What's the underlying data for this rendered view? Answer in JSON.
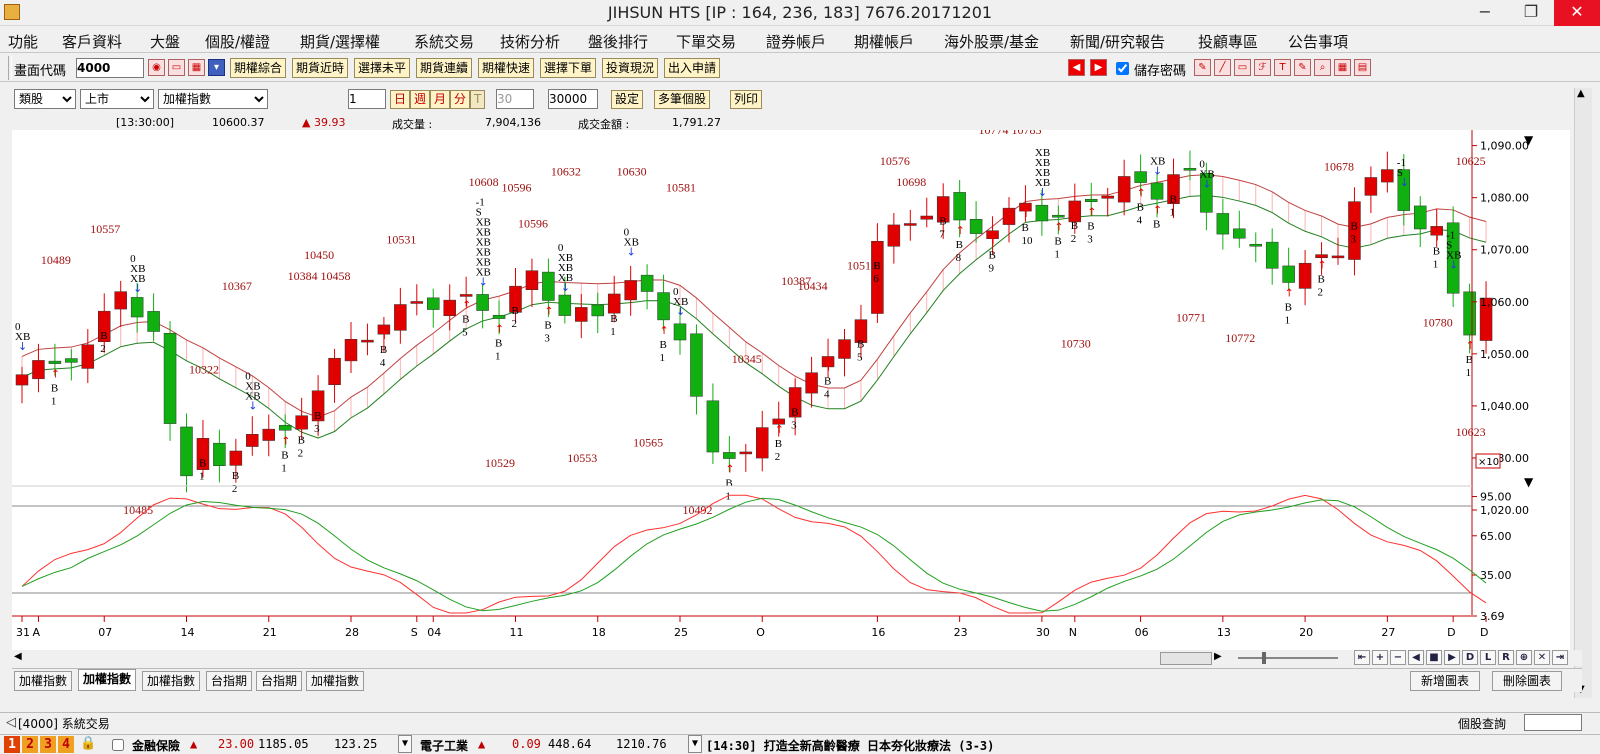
{
  "window": {
    "title": "JIHSUN HTS     [IP : 164, 236, 183] 7676.20171201"
  },
  "menu": [
    "功能",
    "客戶資料",
    "大盤",
    "個股/權證",
    "期貨/選擇權",
    "系統交易",
    "技術分析",
    "盤後排行",
    "下單交易",
    "證券帳戶",
    "期權帳戶",
    "海外股票/基金",
    "新聞/研究報告",
    "投顧專區",
    "公告事項"
  ],
  "toolbar1": {
    "screen_code_label": "畫面代碼",
    "screen_code_value": "4000",
    "buttons": [
      "期權綜合",
      "期貨近時",
      "選擇未平",
      "期貨連續",
      "期權快速",
      "選擇下單",
      "投資現況",
      "出入申請"
    ],
    "save_password_label": "儲存密碼"
  },
  "toolbar2": {
    "category": "類股",
    "market": "上市",
    "index": "加權指數",
    "count_value": "1",
    "periods": [
      "日",
      "週",
      "月",
      "分",
      "T"
    ],
    "period_value": "30",
    "bars_value": "30000",
    "buttons": [
      "設定",
      "多筆個股",
      "列印"
    ]
  },
  "info": {
    "time": "[13:30:00]",
    "price": "10600.37",
    "change": "▲ 39.93",
    "volume_label": "成交量 :",
    "volume": "7,904,136",
    "amount_label": "成交金額 :",
    "amount": "1,791.27"
  },
  "chart_data": {
    "type": "candlestick",
    "price_axis": {
      "ticks": [
        "1,090.00",
        "1,080.00",
        "1,070.00",
        "1,060.00",
        "1,050.00",
        "1,040.00",
        "1,030.00",
        "1,020.00"
      ],
      "multiplier": "×10",
      "ylim": [
        1020,
        1093
      ]
    },
    "osc_axis": {
      "ticks": [
        "95.00",
        "65.00",
        "35.00",
        "3.69"
      ]
    },
    "x_ticks": [
      "31",
      "A",
      "07",
      "14",
      "21",
      "28",
      "S",
      "04",
      "11",
      "18",
      "25",
      "O",
      "16",
      "23",
      "30",
      "N",
      "06",
      "13",
      "20",
      "27",
      "D",
      "D"
    ],
    "price_labels": [
      {
        "t": "10489",
        "x": 2,
        "v": 1068
      },
      {
        "t": "10557",
        "x": 5,
        "v": 1074
      },
      {
        "t": "10485",
        "x": 7,
        "v": 1020
      },
      {
        "t": "10367",
        "x": 13,
        "v": 1063
      },
      {
        "t": "10322",
        "x": 11,
        "v": 1047
      },
      {
        "t": "10450",
        "x": 18,
        "v": 1069
      },
      {
        "t": "10384",
        "x": 17,
        "v": 1065
      },
      {
        "t": "10458",
        "x": 19,
        "v": 1065
      },
      {
        "t": "10531",
        "x": 23,
        "v": 1072
      },
      {
        "t": "10608",
        "x": 28,
        "v": 1083
      },
      {
        "t": "10596",
        "x": 30,
        "v": 1082
      },
      {
        "t": "10596",
        "x": 31,
        "v": 1075
      },
      {
        "t": "10632",
        "x": 33,
        "v": 1085
      },
      {
        "t": "10630",
        "x": 37,
        "v": 1085
      },
      {
        "t": "10581",
        "x": 40,
        "v": 1082
      },
      {
        "t": "10529",
        "x": 29,
        "v": 1029
      },
      {
        "t": "10553",
        "x": 34,
        "v": 1030
      },
      {
        "t": "10565",
        "x": 38,
        "v": 1033
      },
      {
        "t": "10492",
        "x": 41,
        "v": 1020
      },
      {
        "t": "10345",
        "x": 44,
        "v": 1049
      },
      {
        "t": "10387",
        "x": 47,
        "v": 1064
      },
      {
        "t": "10434",
        "x": 48,
        "v": 1063
      },
      {
        "t": "10518",
        "x": 51,
        "v": 1067
      },
      {
        "t": "10576",
        "x": 53,
        "v": 1087
      },
      {
        "t": "10698",
        "x": 54,
        "v": 1083
      },
      {
        "t": "10774",
        "x": 59,
        "v": 1093
      },
      {
        "t": "10785",
        "x": 61,
        "v": 1093
      },
      {
        "t": "10730",
        "x": 64,
        "v": 1052
      },
      {
        "t": "10771",
        "x": 71,
        "v": 1057
      },
      {
        "t": "10772",
        "x": 74,
        "v": 1053
      },
      {
        "t": "10678",
        "x": 80,
        "v": 1086
      },
      {
        "t": "10625",
        "x": 88,
        "v": 1087
      },
      {
        "t": "10780",
        "x": 86,
        "v": 1056
      },
      {
        "t": "10623",
        "x": 88,
        "v": 1035
      }
    ],
    "signals": [
      {
        "x": 0,
        "dir": "s",
        "labels": [
          "0",
          "XB"
        ]
      },
      {
        "x": 2,
        "dir": "b",
        "labels": [
          "B",
          "1"
        ]
      },
      {
        "x": 5,
        "dir": "b",
        "labels": [
          "B",
          "2"
        ]
      },
      {
        "x": 7,
        "dir": "s",
        "labels": [
          "0",
          "XB",
          "XB"
        ]
      },
      {
        "x": 11,
        "dir": "b",
        "labels": [
          "B",
          "1"
        ]
      },
      {
        "x": 13,
        "dir": "b",
        "labels": [
          "B",
          "2"
        ]
      },
      {
        "x": 14,
        "dir": "s",
        "labels": [
          "0",
          "XB",
          "XB"
        ]
      },
      {
        "x": 16,
        "dir": "b",
        "labels": [
          "B",
          "1"
        ]
      },
      {
        "x": 17,
        "dir": "b",
        "labels": [
          "B",
          "2"
        ]
      },
      {
        "x": 18,
        "dir": "b",
        "labels": [
          "B",
          "3"
        ]
      },
      {
        "x": 22,
        "dir": "b",
        "labels": [
          "B",
          "4"
        ]
      },
      {
        "x": 27,
        "dir": "b",
        "labels": [
          "B",
          "5"
        ]
      },
      {
        "x": 28,
        "dir": "s",
        "labels": [
          "-1",
          "S",
          "XB",
          "XB",
          "XB",
          "XB",
          "XB",
          "XB"
        ]
      },
      {
        "x": 29,
        "dir": "b",
        "labels": [
          "B",
          "1"
        ]
      },
      {
        "x": 30,
        "dir": "b",
        "labels": [
          "B",
          "2"
        ]
      },
      {
        "x": 32,
        "dir": "b",
        "labels": [
          "B",
          "3"
        ]
      },
      {
        "x": 33,
        "dir": "s",
        "labels": [
          "0",
          "XB",
          "XB",
          "XB"
        ]
      },
      {
        "x": 36,
        "dir": "b",
        "labels": [
          "B",
          "1"
        ]
      },
      {
        "x": 37,
        "dir": "s",
        "labels": [
          "0",
          "XB"
        ]
      },
      {
        "x": 39,
        "dir": "b",
        "labels": [
          "B",
          "1"
        ]
      },
      {
        "x": 40,
        "dir": "s",
        "labels": [
          "0",
          "XB"
        ]
      },
      {
        "x": 43,
        "dir": "b",
        "labels": [
          "B",
          "1"
        ]
      },
      {
        "x": 46,
        "dir": "b",
        "labels": [
          "B",
          "2"
        ]
      },
      {
        "x": 47,
        "dir": "b",
        "labels": [
          "B",
          "3"
        ]
      },
      {
        "x": 49,
        "dir": "b",
        "labels": [
          "B",
          "4"
        ]
      },
      {
        "x": 51,
        "dir": "b",
        "labels": [
          "B",
          "5"
        ]
      },
      {
        "x": 52,
        "dir": "b",
        "labels": [
          "B",
          "6"
        ]
      },
      {
        "x": 56,
        "dir": "b",
        "labels": [
          "B",
          "7"
        ]
      },
      {
        "x": 57,
        "dir": "b",
        "labels": [
          "B",
          "8"
        ]
      },
      {
        "x": 59,
        "dir": "b",
        "labels": [
          "B",
          "9"
        ]
      },
      {
        "x": 61,
        "dir": "b",
        "labels": [
          "B",
          "10"
        ]
      },
      {
        "x": 62,
        "dir": "s",
        "labels": [
          "XB",
          "XB",
          "XB",
          "XB"
        ]
      },
      {
        "x": 63,
        "dir": "b",
        "labels": [
          "B",
          "1"
        ]
      },
      {
        "x": 64,
        "dir": "b",
        "labels": [
          "B",
          "2"
        ]
      },
      {
        "x": 65,
        "dir": "b",
        "labels": [
          "B",
          "3"
        ]
      },
      {
        "x": 68,
        "dir": "b",
        "labels": [
          "B",
          "4"
        ]
      },
      {
        "x": 69,
        "dir": "s",
        "labels": [
          "XB"
        ]
      },
      {
        "x": 69,
        "dir": "b",
        "labels": [
          "B"
        ]
      },
      {
        "x": 70,
        "dir": "b",
        "labels": [
          "B",
          "1"
        ]
      },
      {
        "x": 72,
        "dir": "s",
        "labels": [
          "0",
          "XB"
        ]
      },
      {
        "x": 77,
        "dir": "b",
        "labels": [
          "B",
          "1"
        ]
      },
      {
        "x": 79,
        "dir": "b",
        "labels": [
          "B",
          "2"
        ]
      },
      {
        "x": 81,
        "dir": "b",
        "labels": [
          "B",
          "3"
        ]
      },
      {
        "x": 84,
        "dir": "s",
        "labels": [
          "-1",
          "S"
        ]
      },
      {
        "x": 86,
        "dir": "b",
        "labels": [
          "B",
          "1"
        ]
      },
      {
        "x": 87,
        "dir": "s",
        "labels": [
          "-1",
          "S",
          "XB"
        ]
      },
      {
        "x": 88,
        "dir": "b",
        "labels": [
          "B",
          "1"
        ]
      }
    ]
  },
  "tabs": [
    "加權指數",
    "加權指數",
    "加權指數",
    "台指期",
    "台指期",
    "加權指數"
  ],
  "right_buttons": [
    "新增圖表",
    "刪除圖表"
  ],
  "status": {
    "left": "[4000] 系統交易",
    "right": "個股查詢"
  },
  "ticker": {
    "nums": [
      "1",
      "2",
      "3",
      "4"
    ],
    "sector1": "金融保險",
    "s1_change": "23.00",
    "s1_value": "1185.05",
    "s1_vol": "123.25",
    "sector2": "電子工業",
    "s2_change": "0.09",
    "s2_value": "448.64",
    "s2_vol": "1210.76",
    "news": "[14:30] 打造全新高齡醫療 日本夯化妝療法 (3-3)"
  },
  "colors": {
    "up": "#e00000",
    "down": "#10b010",
    "band": "#ffb0b0",
    "k_line": "#ff3030",
    "d_line": "#20a020"
  }
}
